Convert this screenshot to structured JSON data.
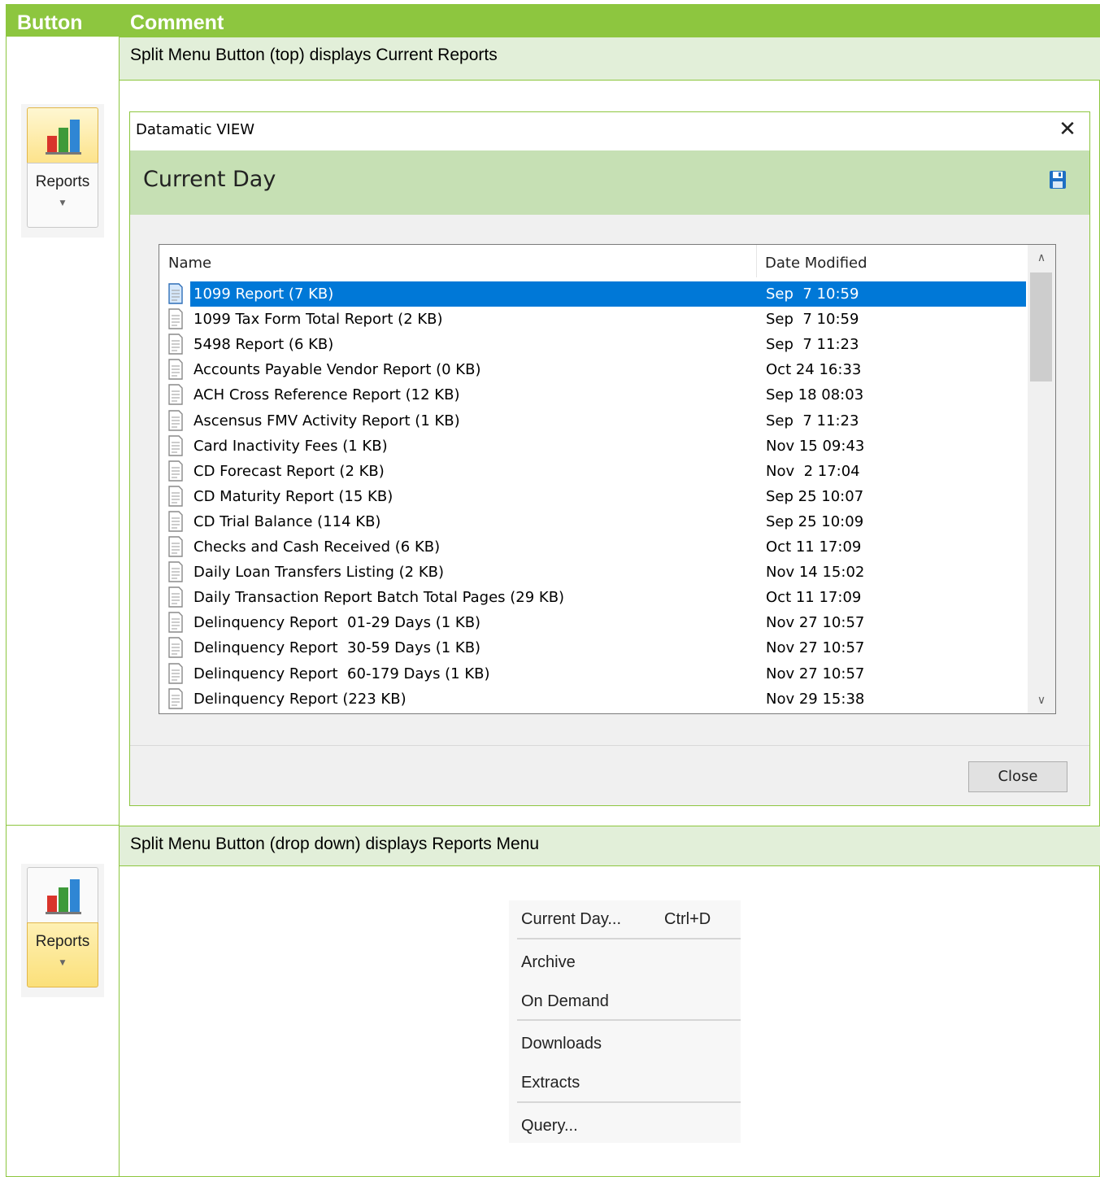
{
  "table": {
    "col_button": "Button",
    "col_comment": "Comment"
  },
  "row1": {
    "comment": "Split Menu Button (top) displays Current Reports",
    "button_label": "Reports"
  },
  "row2": {
    "comment": "Split Menu Button (drop down) displays Reports Menu",
    "button_label": "Reports"
  },
  "dialog": {
    "title": "Datamatic VIEW",
    "heading": "Current Day",
    "columns": {
      "name": "Name",
      "date": "Date Modified"
    },
    "files": [
      {
        "name": "1099 Report (7 KB)",
        "date": "Sep  7 10:59",
        "selected": true
      },
      {
        "name": "1099 Tax Form Total Report (2 KB)",
        "date": "Sep  7 10:59"
      },
      {
        "name": "5498 Report (6 KB)",
        "date": "Sep  7 11:23"
      },
      {
        "name": "Accounts Payable Vendor Report (0 KB)",
        "date": "Oct 24 16:33"
      },
      {
        "name": "ACH Cross Reference Report (12 KB)",
        "date": "Sep 18 08:03"
      },
      {
        "name": "Ascensus FMV Activity Report (1 KB)",
        "date": "Sep  7 11:23"
      },
      {
        "name": "Card Inactivity Fees (1 KB)",
        "date": "Nov 15 09:43"
      },
      {
        "name": "CD Forecast Report (2 KB)",
        "date": "Nov  2 17:04"
      },
      {
        "name": "CD Maturity Report (15 KB)",
        "date": "Sep 25 10:07"
      },
      {
        "name": "CD Trial Balance (114 KB)",
        "date": "Sep 25 10:09"
      },
      {
        "name": "Checks and Cash Received (6 KB)",
        "date": "Oct 11 17:09"
      },
      {
        "name": "Daily Loan Transfers Listing (2 KB)",
        "date": "Nov 14 15:02"
      },
      {
        "name": "Daily Transaction Report Batch Total Pages (29 KB)",
        "date": "Oct 11 17:09"
      },
      {
        "name": "Delinquency Report  01-29 Days (1 KB)",
        "date": "Nov 27 10:57"
      },
      {
        "name": "Delinquency Report  30-59 Days (1 KB)",
        "date": "Nov 27 10:57"
      },
      {
        "name": "Delinquency Report  60-179 Days (1 KB)",
        "date": "Nov 27 10:57"
      },
      {
        "name": "Delinquency Report (223 KB)",
        "date": "Nov 29 15:38"
      }
    ],
    "close_label": "Close"
  },
  "menu": {
    "items": [
      {
        "label": "Current Day...",
        "shortcut": "Ctrl+D"
      },
      {
        "label": "Archive"
      },
      {
        "label": "On Demand"
      },
      {
        "label": "Downloads"
      },
      {
        "label": "Extracts"
      },
      {
        "label": "Query..."
      }
    ]
  },
  "icons": {
    "reports": "bar-chart-icon",
    "save": "save-icon",
    "close": "close-icon",
    "file": "document-icon",
    "scroll_up": "chevron-up-icon",
    "scroll_down": "chevron-down-icon"
  },
  "colors": {
    "accent_green": "#8dc63f",
    "band_green": "#e2efd9",
    "banner_green": "#c6e0b4",
    "selection_blue": "#0078d7"
  }
}
